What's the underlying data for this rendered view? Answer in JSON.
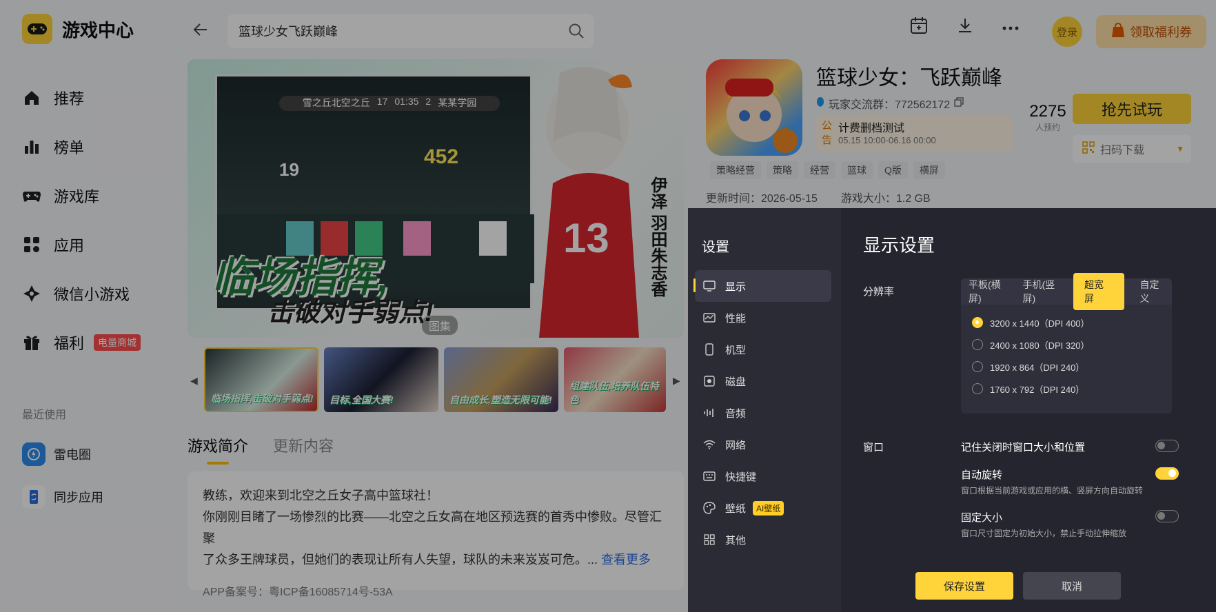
{
  "app": {
    "title": "游戏中心"
  },
  "sidebar": {
    "items": [
      {
        "label": "推荐",
        "icon": "home-icon"
      },
      {
        "label": "榜单",
        "icon": "ranking-icon"
      },
      {
        "label": "游戏库",
        "icon": "gamepad-icon"
      },
      {
        "label": "应用",
        "icon": "apps-icon"
      },
      {
        "label": "微信小游戏",
        "icon": "wechat-game-icon"
      },
      {
        "label": "福利",
        "icon": "gift-icon",
        "badge": "电量商城"
      }
    ],
    "recent_title": "最近使用",
    "recent": [
      {
        "label": "雷电圈",
        "icon": "leidian-circle-icon"
      },
      {
        "label": "同步应用",
        "icon": "sync-app-icon"
      }
    ]
  },
  "topbar": {
    "search_value": "篮球少女飞跃巅峰",
    "login_label": "登录",
    "welfare_label": "领取福利券"
  },
  "banner": {
    "hud_left": "雪之丘北空之丘",
    "hud_score_left": "17",
    "hud_time": "01:35",
    "hud_score_right": "2",
    "hud_right": "某某学园",
    "score_a": "452",
    "score_b": "19",
    "slogan1": "临场指挥,",
    "slogan2": "击破对手弱点!",
    "vertical_name": "伊泽 羽田朱志香",
    "gallery_label": "图集"
  },
  "thumbs": [
    {
      "caption": "临场指挥,击破对手弱点!"
    },
    {
      "caption": "目标,全国大赛!"
    },
    {
      "caption": "自由成长,塑造无限可能!"
    },
    {
      "caption": "组建队伍,培养队伍特色"
    }
  ],
  "tabs": [
    {
      "label": "游戏简介",
      "active": true
    },
    {
      "label": "更新内容",
      "active": false
    }
  ],
  "description": {
    "line1": "教练，欢迎来到北空之丘女子高中篮球社！",
    "line2": "你刚刚目睹了一场惨烈的比赛——北空之丘女高在地区预选赛的首秀中惨败。尽管汇聚",
    "line3": "了众多王牌球员，但她们的表现让所有人失望，球队的未来岌岌可危。... ",
    "more": "查看更多",
    "icp": "APP备案号：粤ICP备16085714号-53A"
  },
  "game": {
    "title": "篮球少女：飞跃巅峰",
    "group": "玩家交流群：772562172",
    "notice_tag": "公告",
    "notice_title": "计费删档测试",
    "notice_time": "05.15 10:00-06.16 00:00",
    "reservations": "2275",
    "reservations_label": "人预约",
    "try_label": "抢先试玩",
    "scan_label": "扫码下载",
    "tags": [
      "策略经营",
      "策略",
      "经营",
      "篮球",
      "Q版",
      "横屏"
    ],
    "update_time": "更新时间：2026-05-15",
    "size": "游戏大小：1.2 GB"
  },
  "settings": {
    "title": "设置",
    "menu": [
      {
        "label": "显示",
        "icon": "monitor-icon",
        "active": true
      },
      {
        "label": "性能",
        "icon": "performance-icon"
      },
      {
        "label": "机型",
        "icon": "phone-icon"
      },
      {
        "label": "磁盘",
        "icon": "disk-icon"
      },
      {
        "label": "音频",
        "icon": "audio-icon"
      },
      {
        "label": "网络",
        "icon": "wifi-icon"
      },
      {
        "label": "快捷键",
        "icon": "keyboard-icon"
      },
      {
        "label": "壁纸",
        "icon": "palette-icon",
        "badge": "AI壁纸"
      },
      {
        "label": "其他",
        "icon": "grid-icon"
      }
    ],
    "heading": "显示设置",
    "resolution_label": "分辨率",
    "resolution_tabs": [
      "平板(横屏)",
      "手机(竖屏)",
      "超宽屏",
      "自定义"
    ],
    "resolution_tab_active": "超宽屏",
    "resolution_options": [
      {
        "label": "3200 x 1440（DPI 400）",
        "selected": true
      },
      {
        "label": "2400 x 1080（DPI 320）",
        "selected": false
      },
      {
        "label": "1920 x 864（DPI 240）",
        "selected": false
      },
      {
        "label": "1760 x 792（DPI 240）",
        "selected": false
      }
    ],
    "window_label": "窗口",
    "window_options": [
      {
        "title": "记住关闭时窗口大小和位置",
        "desc": "",
        "enabled": false
      },
      {
        "title": "自动旋转",
        "desc": "窗口根据当前游戏或应用的横、竖屏方向自动旋转",
        "enabled": true
      },
      {
        "title": "固定大小",
        "desc": "窗口尺寸固定为初始大小，禁止手动拉伸缩放",
        "enabled": false
      }
    ],
    "save_label": "保存设置",
    "cancel_label": "取消"
  },
  "colors": {
    "accent": "#ffd43b",
    "dialog_bg": "#25252f",
    "link": "#2f6fe4"
  }
}
